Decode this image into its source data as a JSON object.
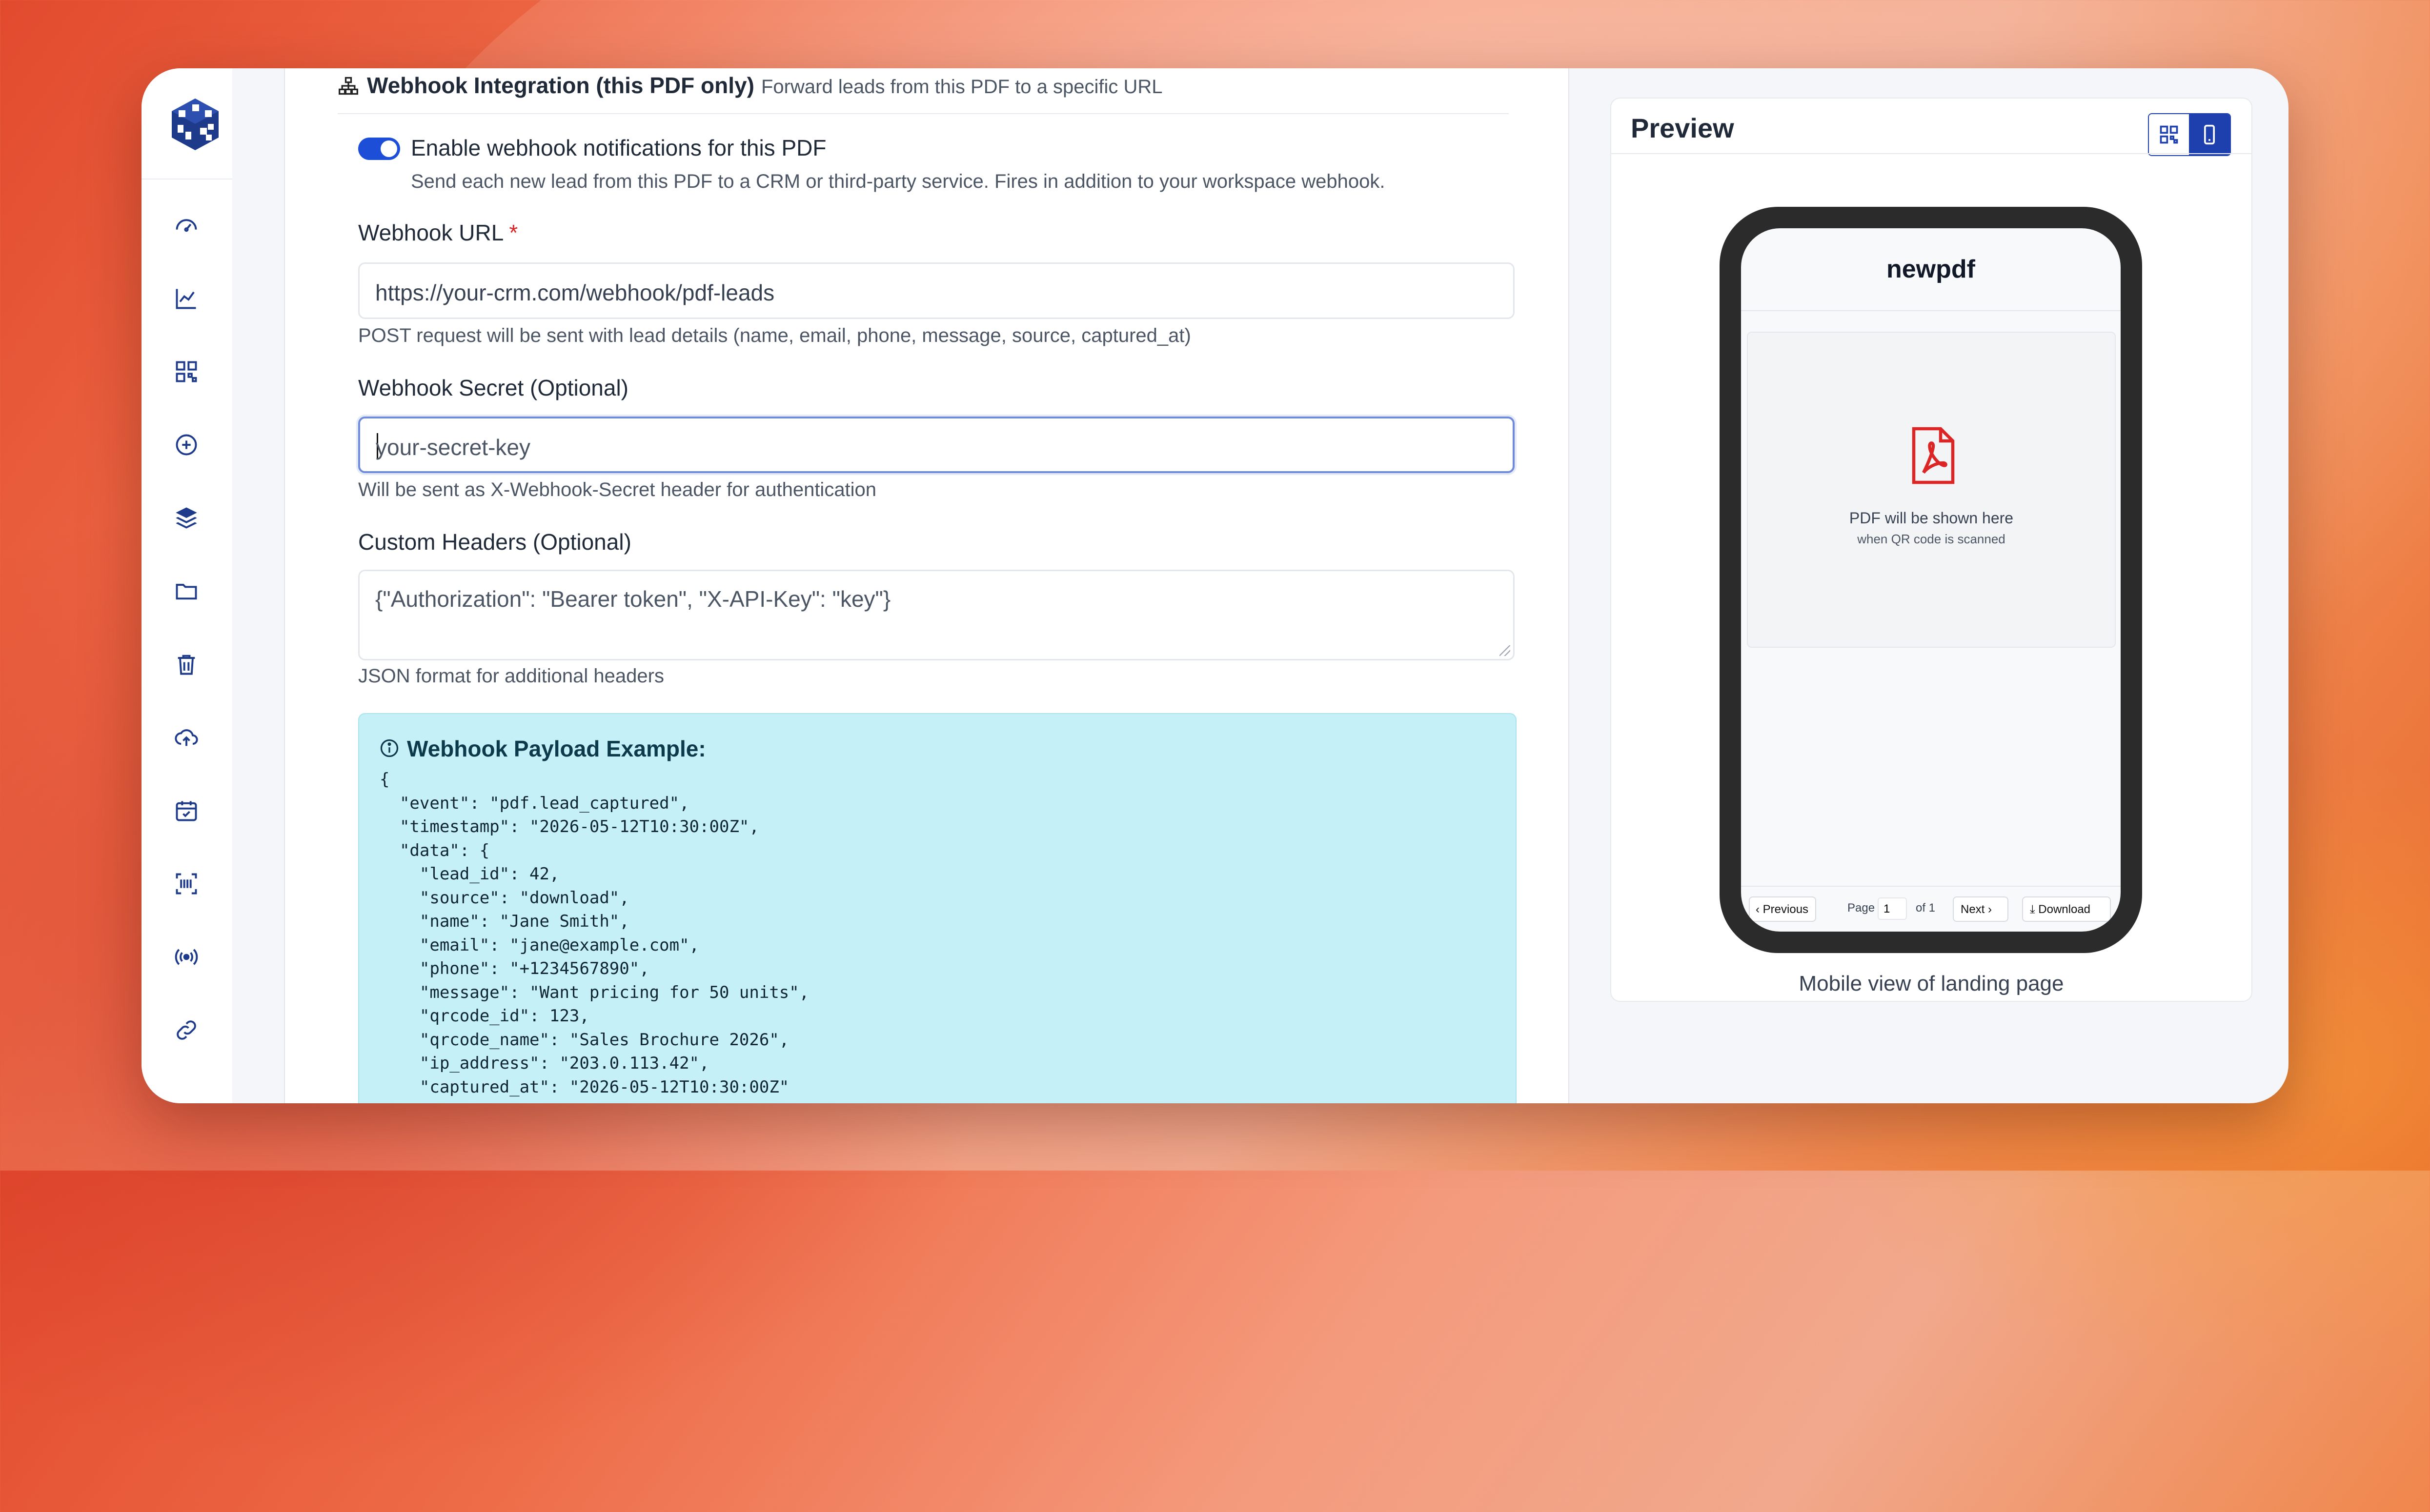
{
  "sidebar": {
    "items": [
      {
        "name": "dashboard"
      },
      {
        "name": "analytics"
      },
      {
        "name": "qr-codes"
      },
      {
        "name": "create"
      },
      {
        "name": "layers"
      },
      {
        "name": "folders"
      },
      {
        "name": "trash"
      },
      {
        "name": "upload"
      },
      {
        "name": "calendar"
      },
      {
        "name": "barcode"
      },
      {
        "name": "broadcast"
      },
      {
        "name": "link"
      }
    ]
  },
  "section": {
    "title": "Webhook Integration (this PDF only)",
    "subtitle": "Forward leads from this PDF to a specific URL"
  },
  "toggle": {
    "enabled": true,
    "label": "Enable webhook notifications for this PDF",
    "help": "Send each new lead from this PDF to a CRM or third-party service. Fires in addition to your workspace webhook."
  },
  "webhook_url": {
    "label": "Webhook URL",
    "required_mark": "*",
    "value": "https://your-crm.com/webhook/pdf-leads",
    "help": "POST request will be sent with lead details (name, email, phone, message, source, captured_at)"
  },
  "webhook_secret": {
    "label": "Webhook Secret (Optional)",
    "placeholder": "your-secret-key",
    "help": "Will be sent as X-Webhook-Secret header for authentication"
  },
  "custom_headers": {
    "label": "Custom Headers (Optional)",
    "placeholder": "{\"Authorization\": \"Bearer token\", \"X-API-Key\": \"key\"}",
    "help": "JSON format for additional headers"
  },
  "payload": {
    "title": "Webhook Payload Example:",
    "code": "{\n  \"event\": \"pdf.lead_captured\",\n  \"timestamp\": \"2026-05-12T10:30:00Z\",\n  \"data\": {\n    \"lead_id\": 42,\n    \"source\": \"download\",\n    \"name\": \"Jane Smith\",\n    \"email\": \"jane@example.com\",\n    \"phone\": \"+1234567890\",\n    \"message\": \"Want pricing for 50 units\",\n    \"qrcode_id\": 123,\n    \"qrcode_name\": \"Sales Brochure 2026\",\n    \"ip_address\": \"203.0.113.42\",\n    \"captured_at\": \"2026-05-12T10:30:00Z\"\n  }"
  },
  "preview": {
    "title": "Preview",
    "phone_title": "newpdf",
    "pdf_line1": "PDF will be shown here",
    "pdf_line2": "when QR code is scanned",
    "prev_label": "Previous",
    "page_label": "Page",
    "page_value": "1",
    "of_label": "of 1",
    "next_label": "Next",
    "download_label": "Download",
    "caption": "Mobile view of landing page"
  },
  "colors": {
    "accent": "#1d4ed8",
    "payload_bg": "#c6f0f8",
    "required": "#dc2626"
  }
}
